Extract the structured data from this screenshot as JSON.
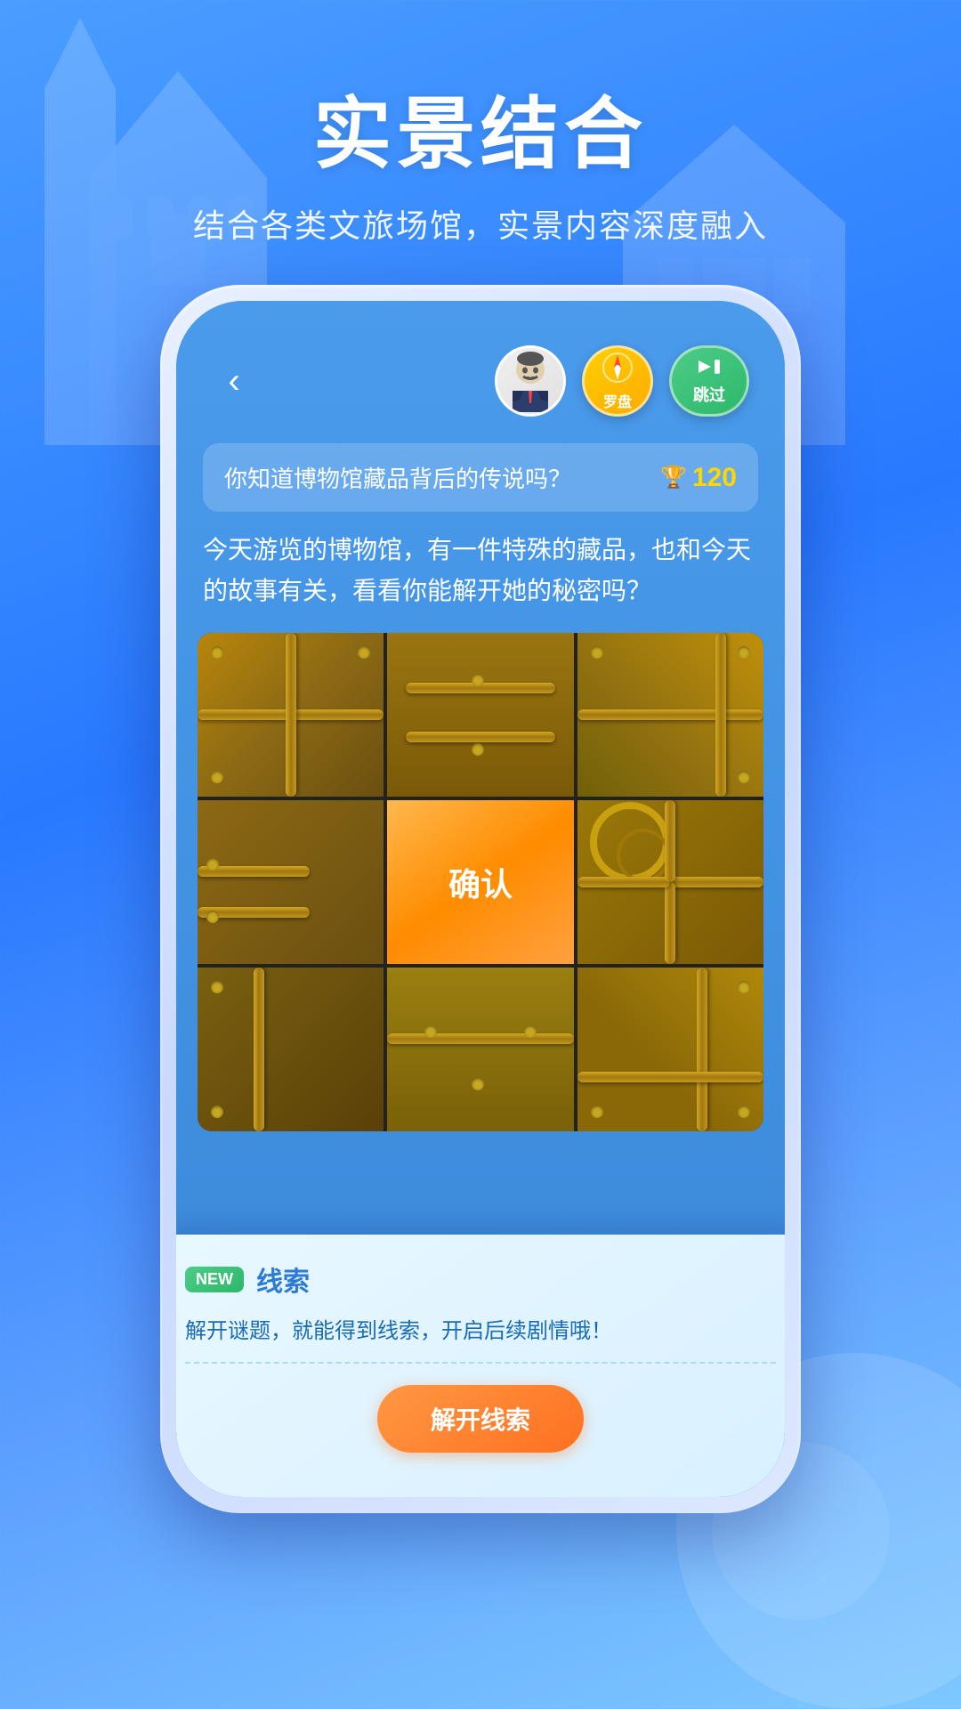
{
  "background": {
    "gradient_start": "#4a9eff",
    "gradient_end": "#7ec8ff"
  },
  "top_section": {
    "main_title": "实景结合",
    "sub_title": "结合各类文旅场馆，实景内容深度融入"
  },
  "phone": {
    "top_bar": {
      "back_label": "‹",
      "compass_label": "罗盘",
      "skip_label": "跳过"
    },
    "question_card": {
      "text": "你知道博物馆藏品背后的传说吗？",
      "score": "120"
    },
    "description": "今天游览的博物馆，有一件特殊的藏品，也和今天的故事有关，看看你能解开她的秘密吗？",
    "puzzle": {
      "confirm_label": "确认"
    },
    "clue_card": {
      "new_badge": "NEW",
      "title": "线索",
      "description": "解开谜题，就能得到线索，开启后续剧情哦！",
      "unlock_button": "解开线索"
    }
  }
}
